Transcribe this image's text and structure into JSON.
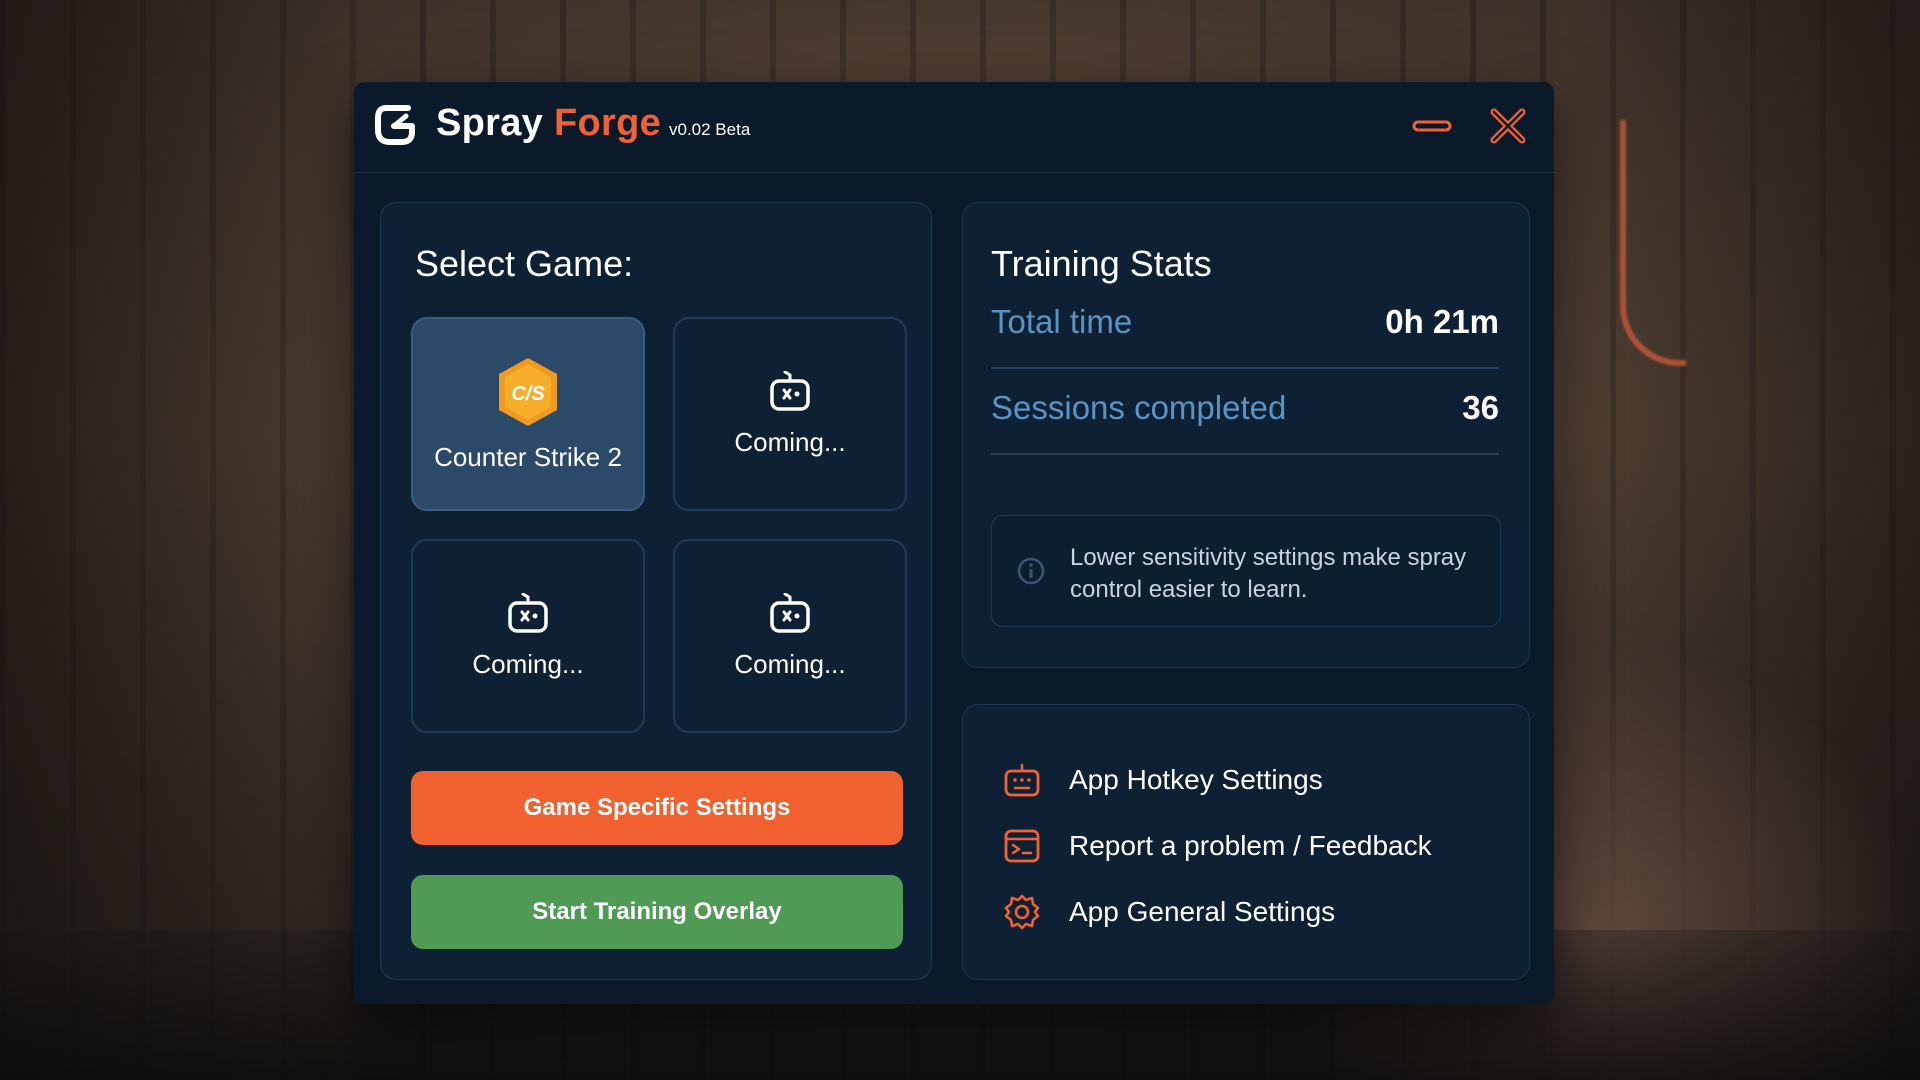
{
  "app": {
    "brand_part1": "Spray",
    "brand_part2": "Forge",
    "version": "v0.02 Beta",
    "accent_color": "#f26132",
    "secondary_color": "#4f9a55",
    "icons": {
      "logo": "spray-forge-logo-icon",
      "minimize": "minimize-icon",
      "close": "close-icon"
    }
  },
  "game_select": {
    "heading": "Select Game:",
    "tiles": [
      {
        "label": "Counter Strike 2",
        "icon": "cs2-logo-icon",
        "selected": true,
        "logo_text": "C/S"
      },
      {
        "label": "Coming...",
        "icon": "gamepad-icon",
        "selected": false
      },
      {
        "label": "Coming...",
        "icon": "gamepad-icon",
        "selected": false
      },
      {
        "label": "Coming...",
        "icon": "gamepad-icon",
        "selected": false
      }
    ],
    "settings_button": "Game Specific Settings",
    "start_button": "Start Training Overlay"
  },
  "stats": {
    "heading": "Training Stats",
    "rows": [
      {
        "label": "Total time",
        "value": "0h 21m"
      },
      {
        "label": "Sessions completed",
        "value": "36"
      }
    ],
    "tip": {
      "icon": "info-icon",
      "text": "Lower sensitivity settings make spray control easier to learn."
    }
  },
  "links": [
    {
      "label": "App Hotkey Settings",
      "icon": "keyboard-icon"
    },
    {
      "label": "Report a problem / Feedback",
      "icon": "feedback-icon"
    },
    {
      "label": "App General Settings",
      "icon": "gear-icon"
    }
  ]
}
